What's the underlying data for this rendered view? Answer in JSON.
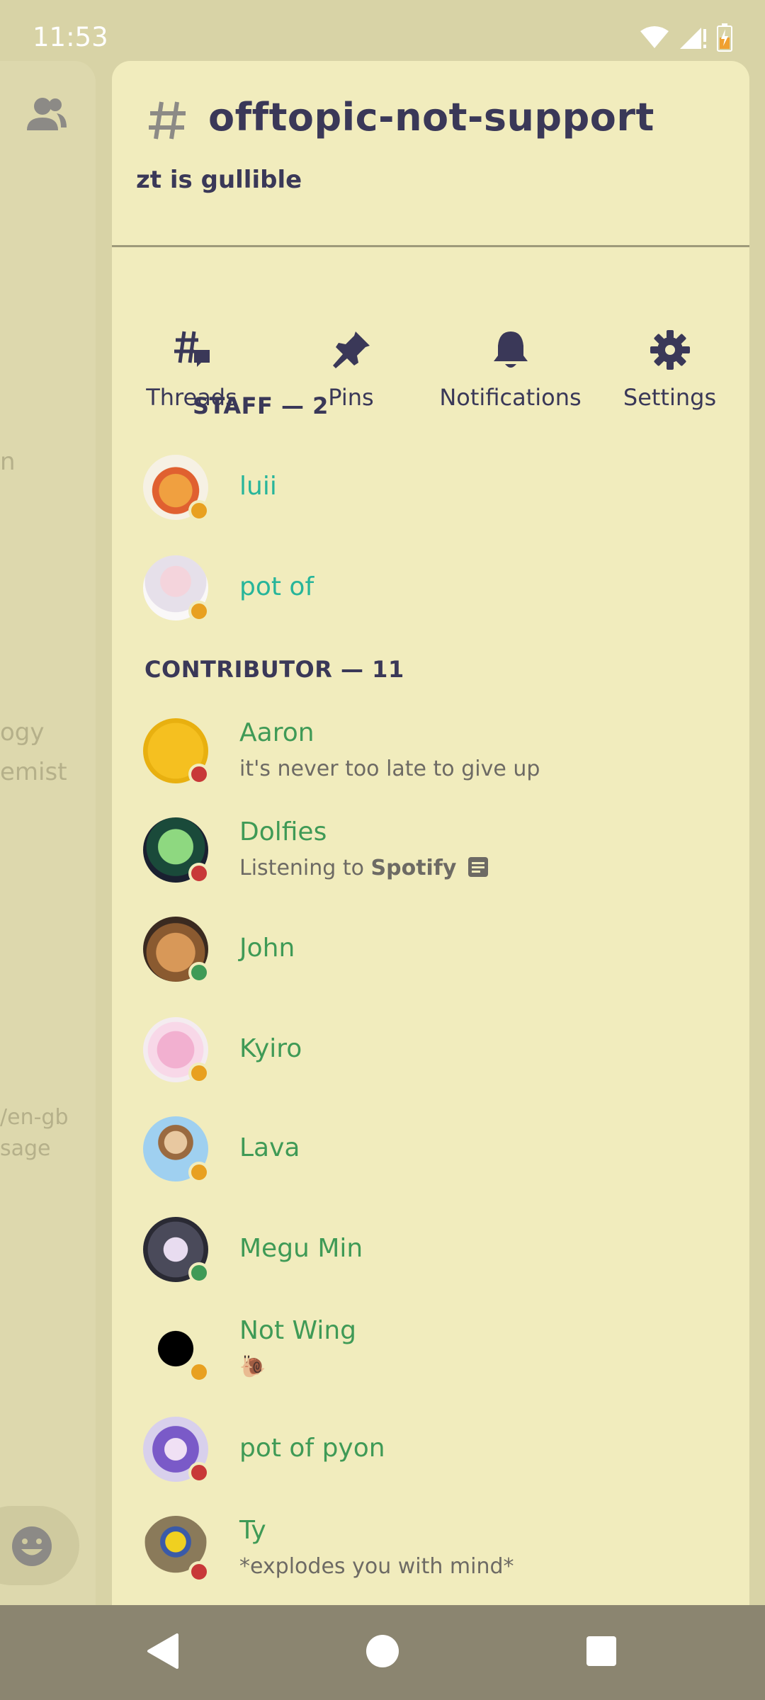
{
  "status": {
    "time": "11:53"
  },
  "background": {
    "fragments": [
      "n",
      "ogy",
      "emist",
      "/en-gb",
      "sage"
    ]
  },
  "channel": {
    "name": "offtopic-not-support",
    "topic": "zt is gullible"
  },
  "actions": [
    {
      "label": "Threads"
    },
    {
      "label": "Pins"
    },
    {
      "label": "Notifications"
    },
    {
      "label": "Settings"
    }
  ],
  "sections": {
    "staff": "STAFF — 2",
    "contributor": "CONTRIBUTOR — 11"
  },
  "staff": [
    {
      "name": "luii"
    },
    {
      "name": "pot of"
    }
  ],
  "contributors": [
    {
      "name": "Aaron",
      "sub": "it's never too late to give up"
    },
    {
      "name": "Dolfies",
      "sub_prefix": "Listening to ",
      "sub_bold": "Spotify"
    },
    {
      "name": "John"
    },
    {
      "name": "Kyiro"
    },
    {
      "name": "Lava"
    },
    {
      "name": "Megu Min"
    },
    {
      "name": "Not Wing",
      "sub": "🐌"
    },
    {
      "name": "pot of pyon"
    },
    {
      "name": "Ty",
      "sub": "*explodes you with mind*"
    }
  ],
  "colors": {
    "staff_name": "#27b59a",
    "contributor_name": "#3f9a56",
    "panel_bg": "#f1ecbd",
    "text_dark": "#3a3858"
  }
}
